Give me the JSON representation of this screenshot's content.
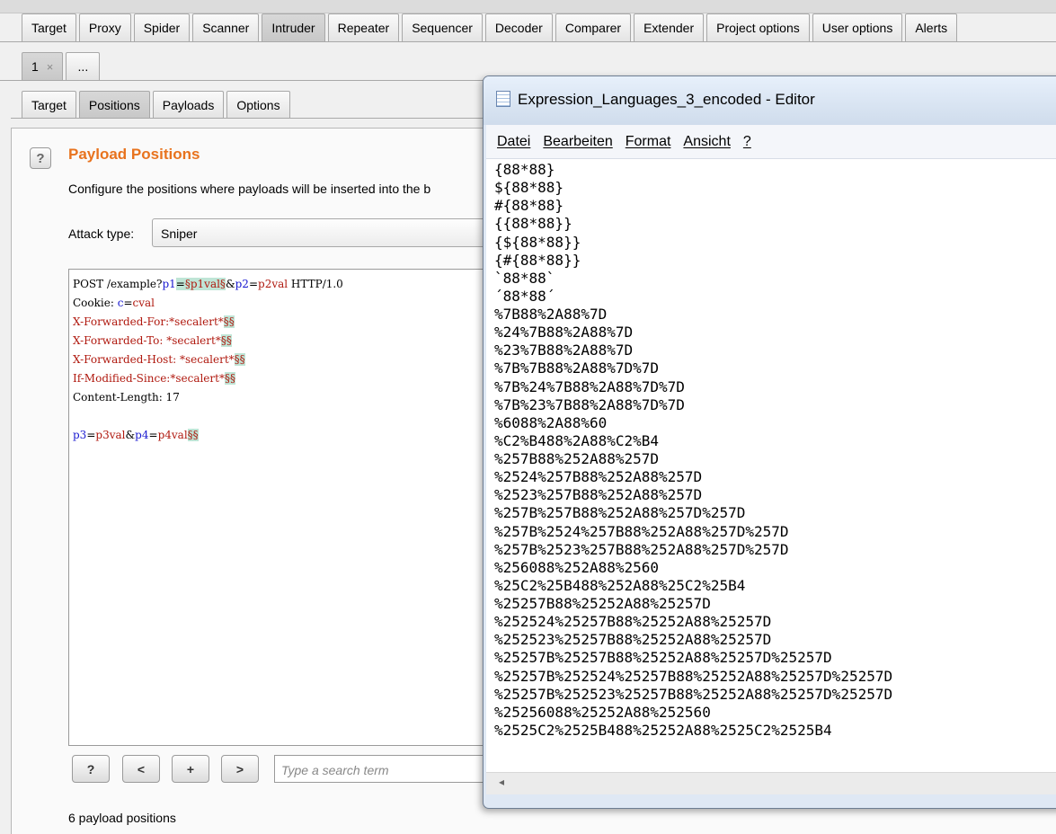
{
  "main_tabs": [
    "Target",
    "Proxy",
    "Spider",
    "Scanner",
    "Intruder",
    "Repeater",
    "Sequencer",
    "Decoder",
    "Comparer",
    "Extender",
    "Project options",
    "User options",
    "Alerts"
  ],
  "active_main_tab": "Intruder",
  "instance_tabs": {
    "tab1": "1",
    "close": "×",
    "more": "..."
  },
  "sub_tabs": [
    "Target",
    "Positions",
    "Payloads",
    "Options"
  ],
  "active_sub_tab": "Positions",
  "positions": {
    "help": "?",
    "title": "Payload Positions",
    "description": "Configure the positions where payloads will be inserted into the b",
    "attack_type_label": "Attack type:",
    "attack_type_value": "Sniper"
  },
  "request": {
    "line1": {
      "a": "POST /example?",
      "p1": "p1",
      "eq1": "=",
      "p1val": "§p1val§",
      "amp": "&",
      "p2": "p2",
      "eq2": "=",
      "p2val": "p2val",
      "tail": " HTTP/1.0"
    },
    "line2": {
      "a": "Cookie: ",
      "c": "c",
      "eq": "=",
      "cval": "cval"
    },
    "headers": [
      {
        "text": "X-Forwarded-For:*secalert*",
        "marker": "§§"
      },
      {
        "text": "X-Forwarded-To: *secalert*",
        "marker": "§§"
      },
      {
        "text": "X-Forwarded-Host: *secalert*",
        "marker": "§§"
      },
      {
        "text": "If-Modified-Since:*secalert*",
        "marker": "§§"
      }
    ],
    "content_length": "Content-Length: 17",
    "body": {
      "p3": "p3",
      "eq3": "=",
      "p3val": "p3val",
      "amp": "&",
      "p4": "p4",
      "eq4": "=",
      "p4val": "p4val",
      "marker": "§§"
    }
  },
  "buttons": {
    "help": "?",
    "prev": "<",
    "add": "+",
    "next": ">"
  },
  "search_placeholder": "Type a search term",
  "payload_count": "6 payload positions",
  "editor": {
    "title": "Expression_Languages_3_encoded - Editor",
    "menu": [
      "Datei",
      "Bearbeiten",
      "Format",
      "Ansicht",
      "?"
    ],
    "lines": [
      "{88*88}",
      "${88*88}",
      "#{88*88}",
      "{{88*88}}",
      "{${88*88}}",
      "{#{88*88}}",
      "`88*88`",
      "´88*88´",
      "%7B88%2A88%7D",
      "%24%7B88%2A88%7D",
      "%23%7B88%2A88%7D",
      "%7B%7B88%2A88%7D%7D",
      "%7B%24%7B88%2A88%7D%7D",
      "%7B%23%7B88%2A88%7D%7D",
      "%6088%2A88%60",
      "%C2%B488%2A88%C2%B4",
      "%257B88%252A88%257D",
      "%2524%257B88%252A88%257D",
      "%2523%257B88%252A88%257D",
      "%257B%257B88%252A88%257D%257D",
      "%257B%2524%257B88%252A88%257D%257D",
      "%257B%2523%257B88%252A88%257D%257D",
      "%256088%252A88%2560",
      "%25C2%25B488%252A88%25C2%25B4",
      "%25257B88%25252A88%25257D",
      "%252524%25257B88%25252A88%25257D",
      "%252523%25257B88%25252A88%25257D",
      "%25257B%25257B88%25252A88%25257D%25257D",
      "%25257B%252524%25257B88%25252A88%25257D%25257D",
      "%25257B%252523%25257B88%25252A88%25257D%25257D",
      "%25256088%25252A88%252560",
      "%2525C2%2525B488%25252A88%2525C2%2525B4"
    ],
    "scroll_left": "◂"
  }
}
